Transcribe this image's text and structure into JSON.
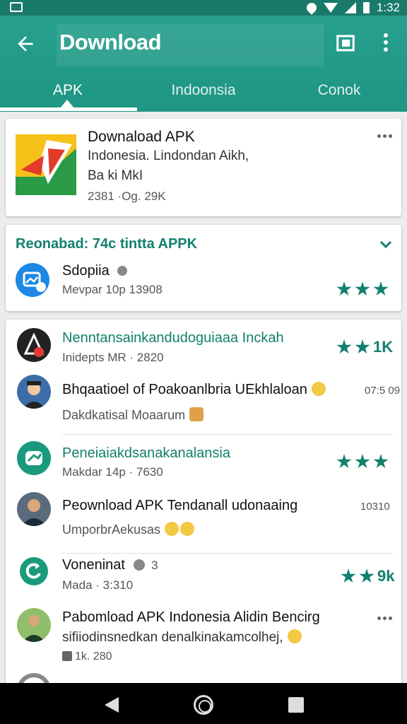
{
  "status_bar": {
    "time": "1:32",
    "icons": [
      "image-icon",
      "location-icon",
      "wifi-icon",
      "signal-icon",
      "battery-icon"
    ]
  },
  "app_bar": {
    "title": "Download",
    "back_icon": "arrow-left-icon",
    "view_icon": "book-icon",
    "more_icon": "more-vert-icon"
  },
  "tabs": [
    {
      "label": "APK",
      "active": true
    },
    {
      "label": "Indoonsia",
      "active": false
    },
    {
      "label": "Conok",
      "active": false
    }
  ],
  "featured": {
    "title": "Downaload APK",
    "line1": "Indonesia. Lindondan Aikh,",
    "line2": "Ba ki MkI",
    "meta": "2381 ·Og. 29K",
    "icon": "app-logo-icon"
  },
  "recommended": {
    "header": "Reonabad: 74c tintta APPK",
    "app_name": "Sdopiia",
    "app_meta": "Mevpar 10p 13908",
    "rating_stars": 3
  },
  "list": [
    {
      "title": "Nenntansainkandudoguiaaa Inckah",
      "sub": "Inidepts MR · 2820",
      "right": "1K",
      "stars": 2,
      "green": true
    },
    {
      "title": "Bhqaatioel of Poakoanlbria UEkhlaloan",
      "sub": "Dakdkatisal Moaarum",
      "right": "07:5 09",
      "stars": 0,
      "green": false
    },
    {
      "title": "Peneiaiakdsanakanalansia",
      "sub": "Makdar 14p · 7630",
      "right": "",
      "stars": 3,
      "green": true
    },
    {
      "title": "Peownload APK Tendanall udonaaing",
      "sub": "UmporbrAekusas",
      "right": "10310",
      "stars": 0,
      "green": false
    },
    {
      "title": "Voneninat",
      "title_suffix": "3",
      "sub": "Mada · 3:310",
      "right": "9k",
      "stars": 2,
      "green": false
    },
    {
      "title": "Pabomload APK Indonesia Alidin Bencirg",
      "sub": "sifiiodinsnedkan denalkinakamcolhej,",
      "sub2": "1k. 280",
      "right": "",
      "stars": 0,
      "green": false
    }
  ],
  "colors": {
    "primary": "#1f9583",
    "accent": "#12806e",
    "status_bar": "#1a7a6a"
  },
  "nav_bar": {
    "icons": [
      "nav-back-icon",
      "nav-home-icon",
      "nav-recents-icon"
    ]
  }
}
